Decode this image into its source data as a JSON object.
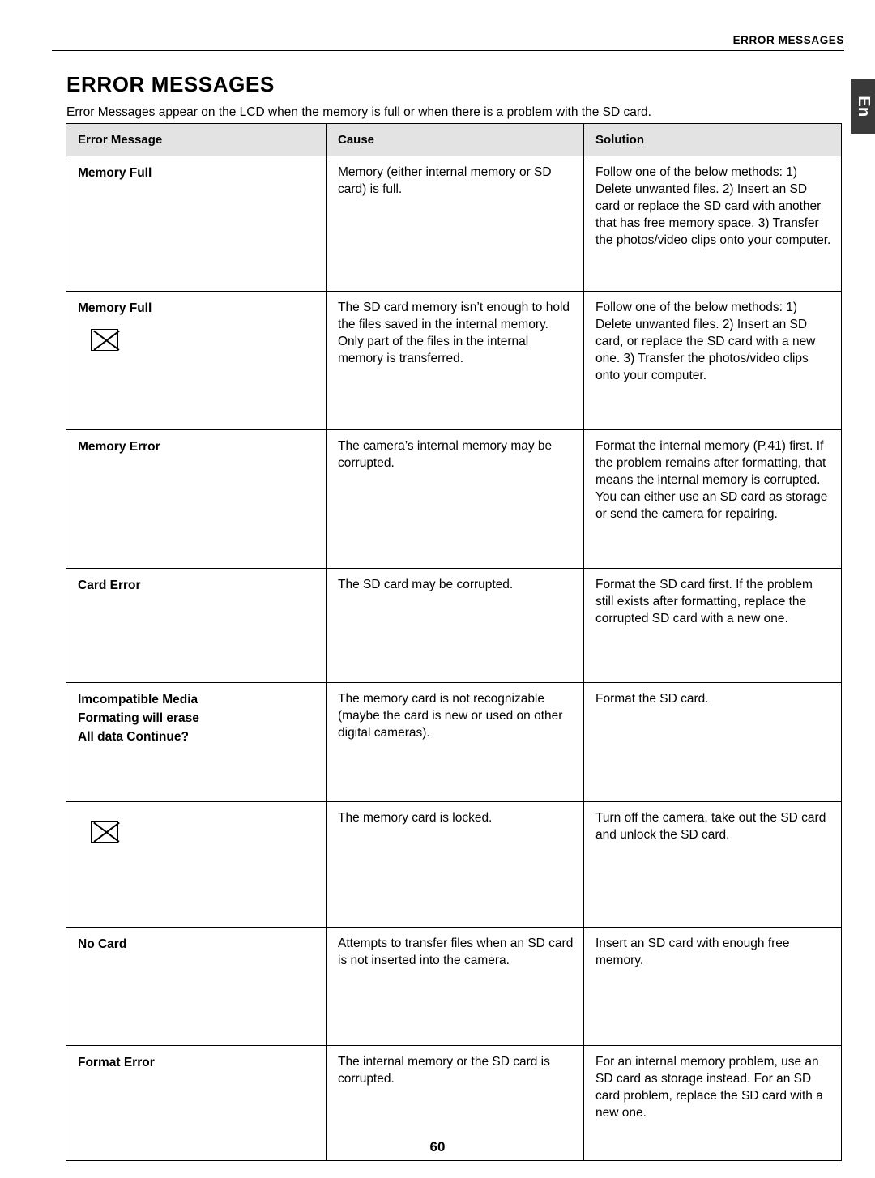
{
  "header": {
    "running_head": "ERROR MESSAGES",
    "side_tab": "En"
  },
  "title": "ERROR MESSAGES",
  "intro": "Error Messages appear on the LCD when the memory is full or when there is a problem with the SD card.",
  "table": {
    "columns": [
      "Error Message",
      "Cause",
      "Solution"
    ],
    "rows": [
      {
        "message_lines": [
          "Memory Full"
        ],
        "icon": null,
        "cause": "Memory (either internal memory or SD card) is full.",
        "solution": "Follow one of the below methods: 1) Delete unwanted files. 2) Insert an SD card or replace the SD card with another that has free memory space. 3) Transfer the photos/video clips onto your computer."
      },
      {
        "message_lines": [
          "Memory Full"
        ],
        "icon": "card-locked-icon",
        "cause": "The SD card memory isn’t enough to hold the files saved in the internal memory. Only part of the files in the internal memory is transferred.",
        "solution": "Follow one of the below methods: 1) Delete unwanted files. 2) Insert an SD card, or replace the SD card with a new one. 3) Transfer the photos/video clips onto your computer."
      },
      {
        "message_lines": [
          "Memory Error"
        ],
        "icon": null,
        "cause": "The camera’s internal memory may be corrupted.",
        "solution": "Format the internal memory (P.41) first. If the problem remains after formatting, that means the internal memory is corrupted. You can either use an SD card as storage or send the camera for repairing."
      },
      {
        "message_lines": [
          "Card Error"
        ],
        "icon": null,
        "cause": "The SD card may be corrupted.",
        "solution": "Format the SD card first. If the problem still exists after formatting, replace the corrupted SD card with a new one."
      },
      {
        "message_lines": [
          "Imcompatible Media",
          "Formating will erase",
          "All data Continue?"
        ],
        "icon": null,
        "cause": "The memory card is not recognizable (maybe the card is new or used on other digital cameras).",
        "solution": "Format the SD card."
      },
      {
        "message_lines": [],
        "icon": "card-locked-icon",
        "cause": "The memory card is locked.",
        "solution": "Turn off the camera, take out the SD card and unlock the SD card."
      },
      {
        "message_lines": [
          "No Card"
        ],
        "icon": null,
        "cause": "Attempts to transfer files when an SD card is not inserted into the camera.",
        "solution": "Insert an SD card with enough free memory."
      },
      {
        "message_lines": [
          "Format Error"
        ],
        "icon": null,
        "cause": "The internal memory or the SD card is corrupted.",
        "solution": "For an internal memory problem, use an SD card as storage instead. For an SD card problem, replace the SD card with a new one."
      }
    ]
  },
  "page_number": "60"
}
